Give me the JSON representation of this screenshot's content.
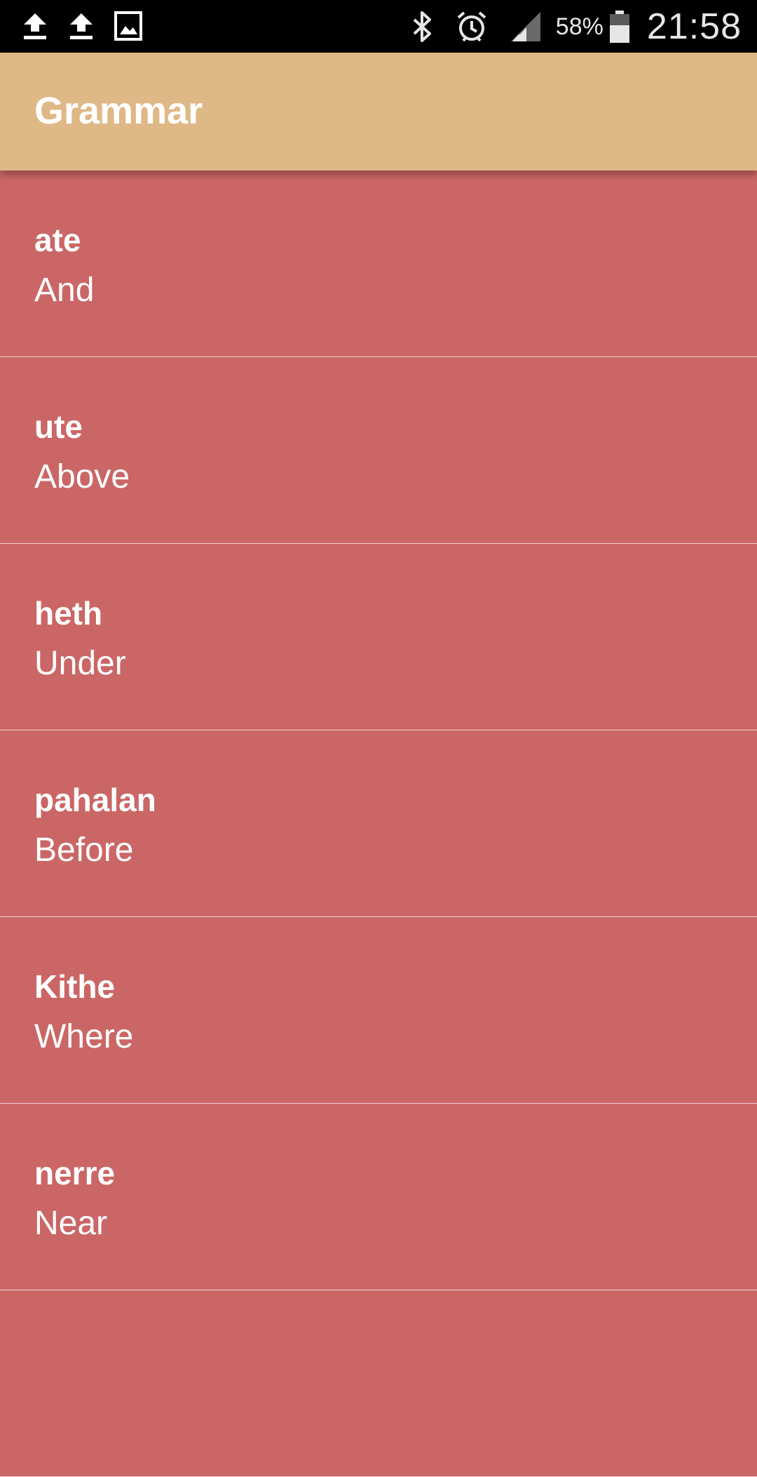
{
  "status_bar": {
    "battery": "58%",
    "time": "21:58",
    "left_icons": [
      "upload-icon",
      "upload-icon",
      "image-icon"
    ],
    "right_icons": [
      "bluetooth-icon",
      "alarm-icon",
      "signal-icon",
      "battery-icon"
    ]
  },
  "app_bar": {
    "title": "Grammar",
    "color": "#dfb887"
  },
  "list": {
    "background": "#cb6666",
    "items": [
      {
        "word": "ate",
        "meaning": "And"
      },
      {
        "word": "ute",
        "meaning": "Above"
      },
      {
        "word": "heth",
        "meaning": "Under"
      },
      {
        "word": "pahalan",
        "meaning": "Before"
      },
      {
        "word": "Kithe",
        "meaning": "Where"
      },
      {
        "word": "nerre",
        "meaning": "Near"
      },
      {
        "word": "",
        "meaning": ""
      }
    ]
  }
}
